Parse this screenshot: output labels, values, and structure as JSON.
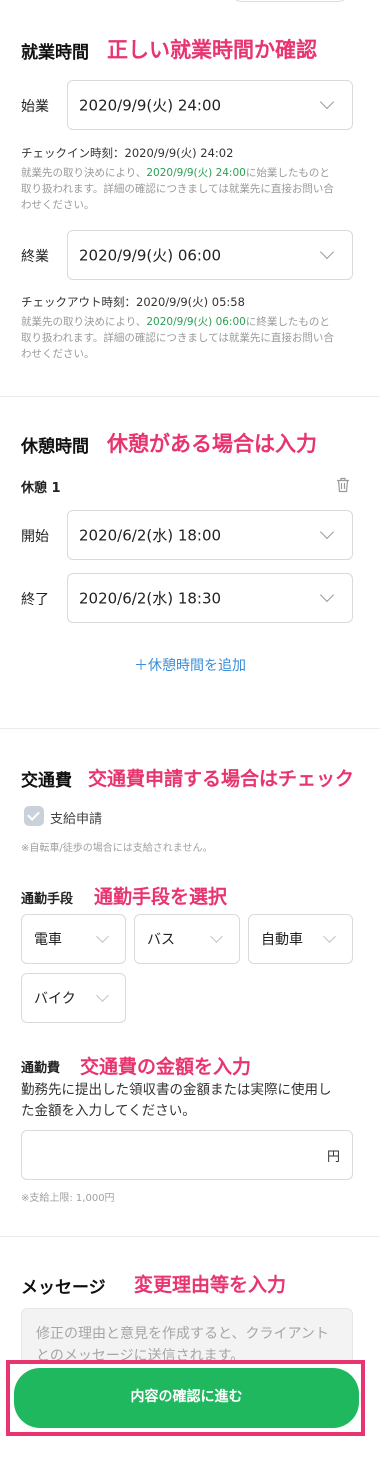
{
  "work_section": {
    "title": "就業時間",
    "annotation": "正しい就業時間か確認",
    "start": {
      "label": "始業",
      "value": "2020/9/9(火) 24:00",
      "checkin_text": "チェックイン時刻：2020/9/9(火) 24:02",
      "note_pre": "就業先の取り決めにより、",
      "note_time": "2020/9/9(火) 24:00",
      "note_post": "に始業したものと",
      "note_line2": "取り扱われます。詳細の確認につきましては就業先に直接お問い合",
      "note_line3": "わせください。"
    },
    "end": {
      "label": "終業",
      "value": "2020/9/9(火) 06:00",
      "checkout_text": "チェックアウト時刻：2020/9/9(火) 05:58",
      "note_pre": "就業先の取り決めにより、",
      "note_time": "2020/9/9(火) 06:00",
      "note_post": "に終業したものと",
      "note_line2": "取り扱われます。詳細の確認につきましては就業先に直接お問い合",
      "note_line3": "わせください。"
    }
  },
  "break_section": {
    "title": "休憩時間",
    "annotation": "休憩がある場合は入力",
    "item_title": "休憩 1",
    "start_label": "開始",
    "start_value": "2020/6/2(水) 18:00",
    "end_label": "終了",
    "end_value": "2020/6/2(水) 18:30",
    "add_link": "＋休憩時間を追加"
  },
  "transport_section": {
    "title": "交通費",
    "annotation": "交通費申請する場合はチェック",
    "checkbox_label": "支給申請",
    "checkbox_note": "※自転車/徒歩の場合には支給されません。",
    "means_label": "通勤手段",
    "means_annotation": "通勤手段を選択",
    "means_options": [
      "電車",
      "バス",
      "自動車",
      "バイク"
    ],
    "fee_label": "通勤費",
    "fee_annotation": "交通費の金額を入力",
    "fee_desc_line1": "勤務先に提出した領収書の金額または実際に使用し",
    "fee_desc_line2": "た金額を入力してください。",
    "currency": "円",
    "limit_note": "※支給上限: 1,000円"
  },
  "message_section": {
    "title": "メッセージ",
    "annotation": "変更理由等を入力",
    "placeholder_line1": "修正の理由と意見を作成すると、クライアント",
    "placeholder_line2": "とのメッセージに送信されます。"
  },
  "cta": {
    "label": "内容の確認に進む"
  },
  "colors": {
    "accent_green": "#20b85f",
    "annotation_pink": "#e8356f",
    "link_blue": "#3a8ed8"
  }
}
